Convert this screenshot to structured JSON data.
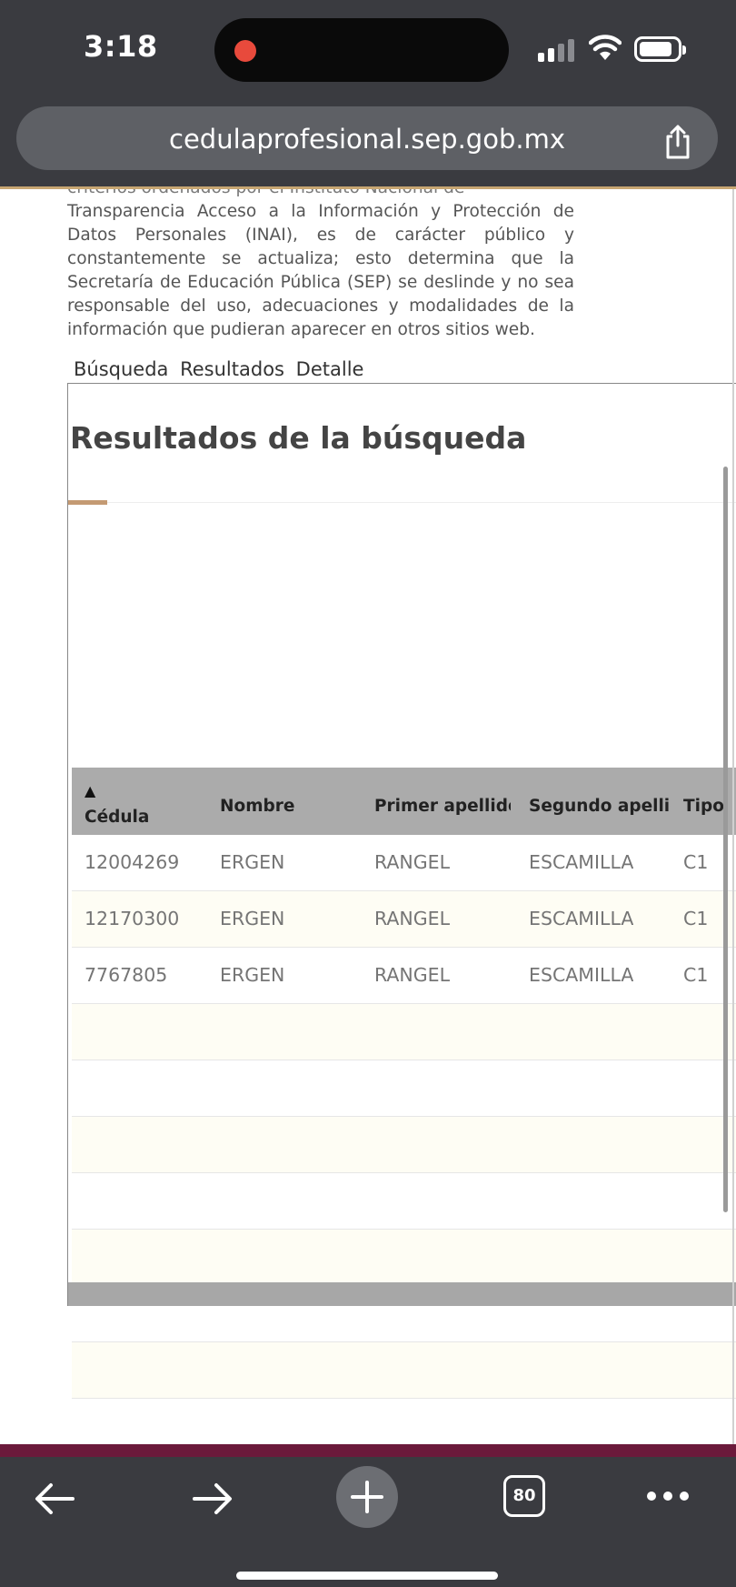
{
  "status_bar": {
    "time": "3:18",
    "icons": [
      "recording-dot-icon",
      "cellular-signal-icon",
      "wifi-icon",
      "battery-icon"
    ]
  },
  "browser": {
    "url": "cedulaprofesional.sep.gob.mx",
    "tab_count": "80",
    "toolbar_icons": [
      "back-arrow-icon",
      "forward-arrow-icon",
      "plus-icon",
      "tabs-icon",
      "more-icon"
    ],
    "share_icon": "share-icon"
  },
  "page": {
    "disclaimer_partial": "criterios ordenados por el Instituto Nacional de",
    "disclaimer": "Transparencia  Acceso a la Información y Protección de Datos Personales (INAI), es de carácter público y constantemente se actualiza; esto determina que la Secretaría de Educación Pública (SEP) se deslinde y no sea responsable del uso, adecuaciones y modalidades de la información que pudieran aparecer en otros sitios web.",
    "tabs": [
      "Búsqueda",
      "Resultados",
      "Detalle"
    ],
    "results_title": "Resultados de la búsqueda",
    "table": {
      "sort_icon": "▲",
      "columns": [
        "Cédula",
        "Nombre",
        "Primer apellido",
        "Segundo apellido",
        "Tipo"
      ],
      "rows": [
        [
          "12004269",
          "ERGEN",
          "RANGEL",
          "ESCAMILLA",
          "C1"
        ],
        [
          "12170300",
          "ERGEN",
          "RANGEL",
          "ESCAMILLA",
          "C1"
        ],
        [
          "7767805",
          "ERGEN",
          "RANGEL",
          "ESCAMILLA",
          "C1"
        ]
      ]
    }
  },
  "colors": {
    "chrome": "#3a3b40",
    "accent_gold": "#c49a73",
    "header_gray": "#ababab",
    "maroon": "#6b1a3b",
    "row_alt": "#fefdf4"
  }
}
